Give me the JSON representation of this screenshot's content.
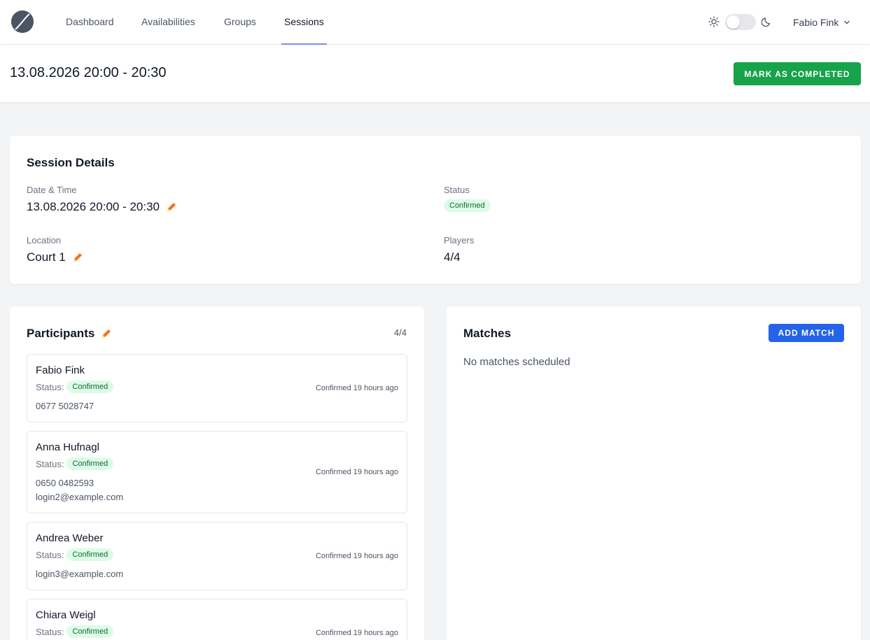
{
  "nav": {
    "links": [
      {
        "label": "Dashboard"
      },
      {
        "label": "Availabilities"
      },
      {
        "label": "Groups"
      },
      {
        "label": "Sessions"
      }
    ],
    "user_name": "Fabio Fink"
  },
  "header": {
    "title": "13.08.2026 20:00 - 20:30",
    "complete_label": "MARK AS COMPLETED"
  },
  "details": {
    "title": "Session Details",
    "datetime_label": "Date & Time",
    "datetime_value": "13.08.2026 20:00 - 20:30",
    "status_label": "Status",
    "status_value": "Confirmed",
    "location_label": "Location",
    "location_value": "Court 1",
    "players_label": "Players",
    "players_value": "4/4"
  },
  "participants": {
    "title": "Participants",
    "count": "4/4",
    "status_label": "Status:",
    "items": [
      {
        "name": "Fabio Fink",
        "status": "Confirmed",
        "time": "Confirmed 19 hours ago",
        "phone": "0677 5028747",
        "email": ""
      },
      {
        "name": "Anna Hufnagl",
        "status": "Confirmed",
        "time": "Confirmed 19 hours ago",
        "phone": "0650 0482593",
        "email": "login2@example.com"
      },
      {
        "name": "Andrea Weber",
        "status": "Confirmed",
        "time": "Confirmed 19 hours ago",
        "phone": "",
        "email": "login3@example.com"
      },
      {
        "name": "Chiara Weigl",
        "status": "Confirmed",
        "time": "Confirmed 19 hours ago",
        "phone": "",
        "email": ""
      }
    ]
  },
  "matches": {
    "title": "Matches",
    "add_label": "ADD MATCH",
    "empty_text": "No matches scheduled"
  },
  "colors": {
    "primary_green": "#16a34a",
    "primary_blue": "#2563eb",
    "badge_bg": "#dcfce7",
    "badge_text": "#166534",
    "active_tab": "#818cf8",
    "pencil": "#f97316"
  }
}
